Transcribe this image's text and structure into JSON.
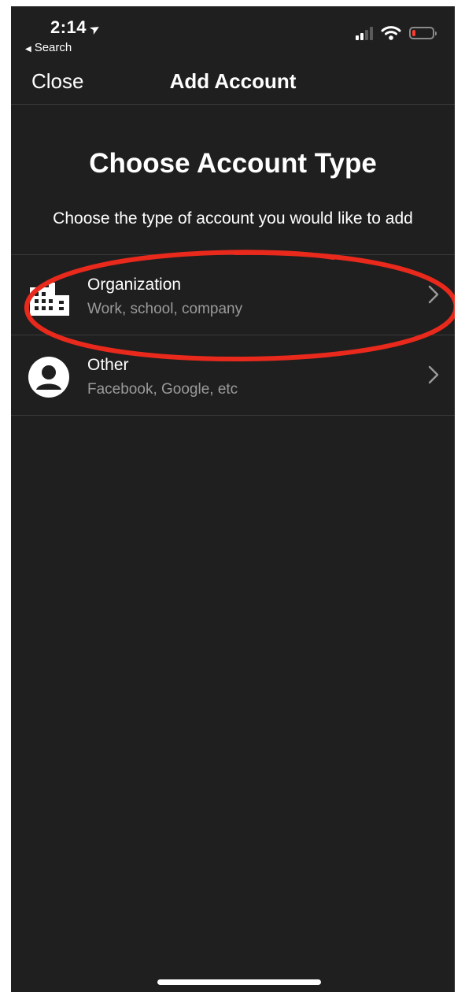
{
  "status_bar": {
    "time": "2:14",
    "back_label": "Search",
    "icons": [
      "location-arrow-icon",
      "cellular-signal-icon",
      "wifi-icon",
      "battery-low-icon"
    ],
    "signal_bars_active": 2,
    "signal_bars_total": 4,
    "battery_level": 0.15,
    "battery_color": "#ff3b30"
  },
  "nav": {
    "close_label": "Close",
    "title": "Add Account"
  },
  "main": {
    "heading": "Choose Account Type",
    "subheading": "Choose the type of account you would like to add",
    "options": [
      {
        "title": "Organization",
        "subtitle": "Work, school, company",
        "icon": "building-icon"
      },
      {
        "title": "Other",
        "subtitle": "Facebook, Google, etc",
        "icon": "person-icon"
      }
    ]
  },
  "colors": {
    "background": "#1f1f1f",
    "separator": "#3a3a3a",
    "secondary_text": "#9a9a9a",
    "annotation_ring": "#e8291c"
  }
}
